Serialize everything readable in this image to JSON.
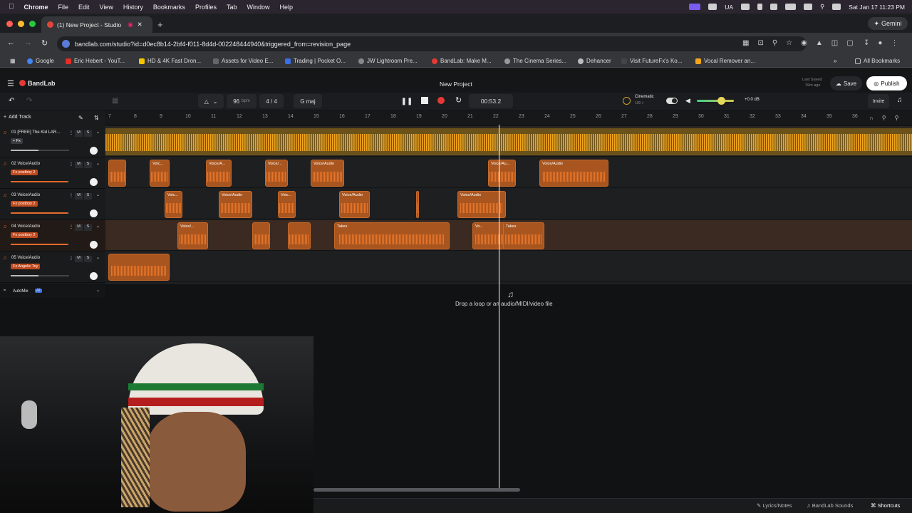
{
  "menubar": {
    "items": [
      "Chrome",
      "File",
      "Edit",
      "View",
      "History",
      "Bookmarks",
      "Profiles",
      "Tab",
      "Window",
      "Help"
    ],
    "status_lang": "UA",
    "datetime": "Sat Jan 17  11:23 PM"
  },
  "browser": {
    "tab_title": "(1) New Project - Studio",
    "url": "bandlab.com/studio?id=d0ec8b14-2bf4-f011-8d4d-002248444940&triggered_from=revision_page",
    "gemini_label": "Gemini",
    "bookmarks": [
      "Google",
      "Eric Hebert - YouT...",
      "HD & 4K Fast Dron...",
      "Assets for Video E...",
      "Trading | Pocket O...",
      "JW Lightroom Pre...",
      "BandLab: Make M...",
      "The Cinema Series...",
      "Dehancer",
      "Visit FutureFx's Ko...",
      "Vocal Remover an..."
    ],
    "all_bookmarks": "All Bookmarks"
  },
  "bandlab": {
    "logo": "BandLab",
    "project_title": "New Project",
    "last_saved_label": "Last Saved",
    "last_saved_value": "19m ago",
    "save_label": "Save",
    "publish_label": "Publish",
    "invite_label": "Invite",
    "tempo": "96",
    "tempo_unit": "bpm",
    "time_signature": "4 / 4",
    "key": "G maj",
    "time_display": "00:53.2",
    "preset_name": "Cinematic",
    "preset_sub": "100 >",
    "master_db": "+0.0 dB",
    "add_track_label": "Add Track",
    "automix_label": "AutoMix",
    "automix_badge": "AI",
    "drop_text": "Drop a loop or an audio/MIDI/video file",
    "ruler_ticks": [
      "7",
      "8",
      "9",
      "10",
      "11",
      "12",
      "13",
      "14",
      "15",
      "16",
      "17",
      "18",
      "19",
      "20",
      "21",
      "22",
      "23",
      "24",
      "25",
      "26",
      "27",
      "28",
      "29",
      "30",
      "31",
      "32",
      "33",
      "34",
      "35",
      "36"
    ],
    "tracks": [
      {
        "name": "01  [FREE] The Kid LAR...",
        "fx": "+ Fx",
        "volume": 0.48
      },
      {
        "name": "02  Voice/Audio",
        "fx": "Fx  postboy 2",
        "volume": 0.98
      },
      {
        "name": "03  Voice/Audio",
        "fx": "Fx  postboy 2",
        "volume": 0.98
      },
      {
        "name": "04  Voice/Audio",
        "fx": "Fx  postboy 2",
        "volume": 0.98
      },
      {
        "name": "05  Voice/Audio",
        "fx": "Fx  Angelic Toy",
        "volume": 0.48
      }
    ],
    "clip_labels": {
      "voice": "Voice/Audio",
      "voice_short": "Voic...",
      "voice_a": "Voice/A...",
      "voice_slash": "Voice/...",
      "voice_au": "Voice/Au...",
      "vo": "Vo...",
      "takes": "Takes"
    },
    "ms_m": "M",
    "ms_s": "S",
    "status_items": [
      "Lyrics/Notes",
      "BandLab Sounds",
      "Shortcuts"
    ]
  },
  "colors": {
    "accent": "#e85d1f",
    "beat_waveform": "#f0a51c",
    "record": "#e53935"
  }
}
